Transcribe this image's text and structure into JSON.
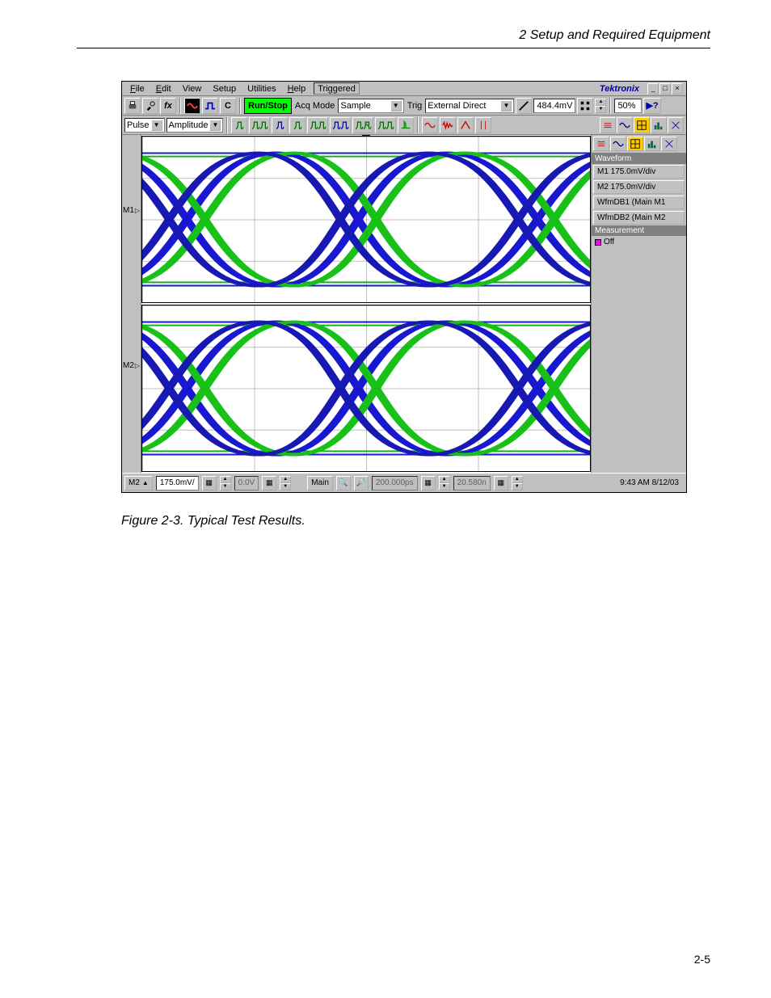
{
  "doc": {
    "header": "2  Setup and Required Equipment",
    "caption": "Figure 2-3. Typical Test Results.",
    "page_number": "2-5"
  },
  "menubar": {
    "items": [
      "File",
      "Edit",
      "View",
      "Setup",
      "Utilities",
      "Help"
    ],
    "status": "Triggered",
    "brand": "Tektronix"
  },
  "toolbar1": {
    "run_stop": "Run/Stop",
    "acq_mode_label": "Acq Mode",
    "acq_mode_value": "Sample",
    "trig_label": "Trig",
    "trig_value": "External Direct",
    "level_value": "484.4mV",
    "zoom_value": "50%"
  },
  "toolbar2": {
    "mode1": "Pulse",
    "mode2": "Amplitude"
  },
  "sidebar": {
    "header1": "Waveform",
    "items": [
      "M1 175.0mV/div",
      "M2 175.0mV/div",
      "WfmDB1 (Main M1",
      "WfmDB2 (Main M2"
    ],
    "header2": "Measurement",
    "off": "Off"
  },
  "channels": {
    "m1": "M1",
    "m2": "M2"
  },
  "statusbar": {
    "ch_select": "M2",
    "vdiv": "175.0mV/",
    "offset": "0.0V",
    "timebase": "Main",
    "tdiv": "200.000ps",
    "delay": "20.580n",
    "timestamp": "9:43 AM 8/12/03"
  }
}
